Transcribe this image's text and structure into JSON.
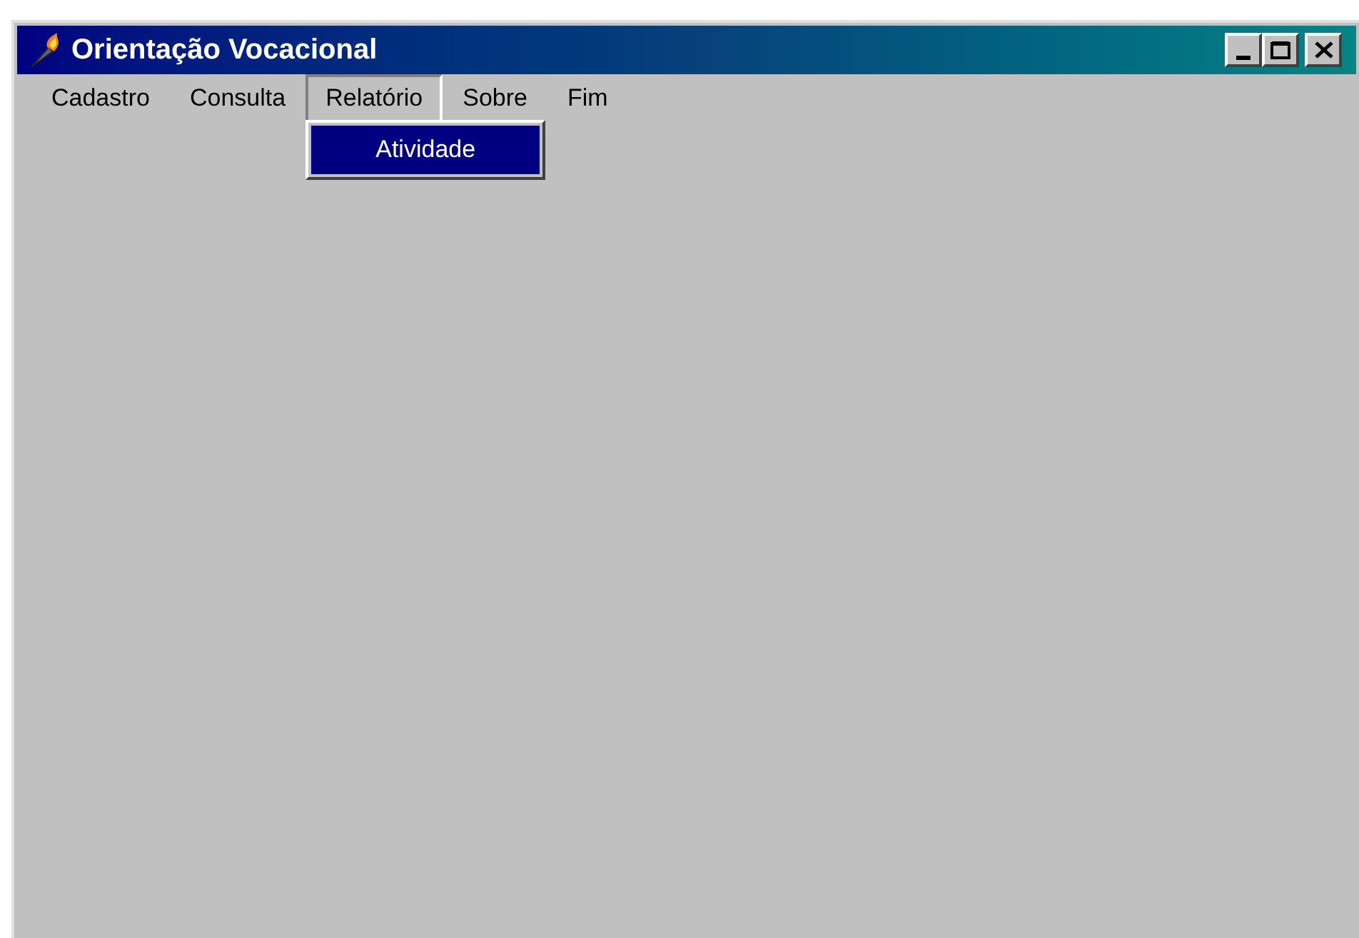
{
  "window": {
    "title": "Orientação Vocacional"
  },
  "menu_bar": [
    {
      "label": "Cadastro",
      "selected": false
    },
    {
      "label": "Consulta",
      "selected": false
    },
    {
      "label": "Relatório",
      "selected": true,
      "submenu": [
        {
          "label": "Atividade",
          "selected": true
        }
      ]
    },
    {
      "label": "Sobre",
      "selected": false
    },
    {
      "label": "Fim",
      "selected": false
    }
  ]
}
